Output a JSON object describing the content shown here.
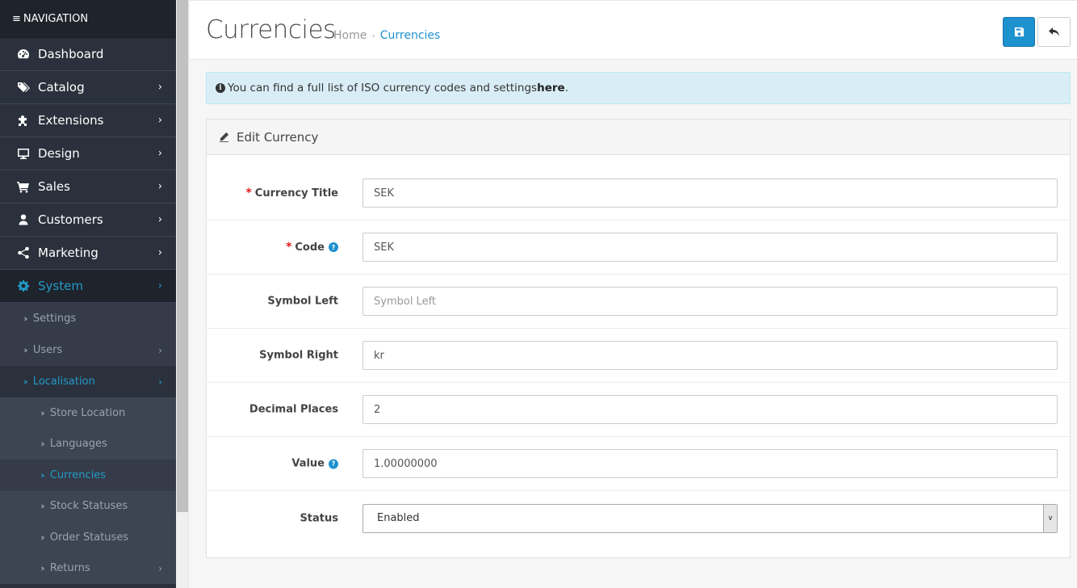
{
  "nav": {
    "header": "NAVIGATION",
    "items": [
      {
        "label": "Dashboard",
        "icon": "dashboard-icon"
      },
      {
        "label": "Catalog",
        "icon": "tags-icon"
      },
      {
        "label": "Extensions",
        "icon": "puzzle-icon"
      },
      {
        "label": "Design",
        "icon": "monitor-icon"
      },
      {
        "label": "Sales",
        "icon": "cart-icon"
      },
      {
        "label": "Customers",
        "icon": "user-icon"
      },
      {
        "label": "Marketing",
        "icon": "share-icon"
      },
      {
        "label": "System",
        "icon": "gear-icon"
      }
    ],
    "system_sub": [
      {
        "label": "Settings"
      },
      {
        "label": "Users"
      },
      {
        "label": "Localisation"
      }
    ],
    "localisation_sub": [
      {
        "label": "Store Location"
      },
      {
        "label": "Languages"
      },
      {
        "label": "Currencies"
      },
      {
        "label": "Stock Statuses"
      },
      {
        "label": "Order Statuses"
      },
      {
        "label": "Returns"
      }
    ]
  },
  "header": {
    "title": "Currencies",
    "breadcrumb": {
      "home": "Home",
      "sep": "›",
      "current": "Currencies"
    }
  },
  "alert": {
    "text": " You can find a full list of ISO currency codes and settings ",
    "link": "here",
    "end": "."
  },
  "panel": {
    "heading": "Edit Currency",
    "fields": {
      "title": {
        "label": "Currency Title",
        "value": "SEK"
      },
      "code": {
        "label": "Code",
        "value": "SEK"
      },
      "symbol_left": {
        "label": "Symbol Left",
        "value": "",
        "placeholder": "Symbol Left"
      },
      "symbol_right": {
        "label": "Symbol Right",
        "value": "kr"
      },
      "decimal_places": {
        "label": "Decimal Places",
        "value": "2"
      },
      "value": {
        "label": "Value",
        "value": "1.00000000"
      },
      "status": {
        "label": "Status",
        "value": "Enabled"
      }
    },
    "required_mark": "*",
    "help_mark": "?"
  },
  "colors": {
    "sidebar_bg": "#2b313c",
    "accent": "#1e91cf",
    "alert_bg": "#d9edf7",
    "required": "#e01c1c"
  }
}
